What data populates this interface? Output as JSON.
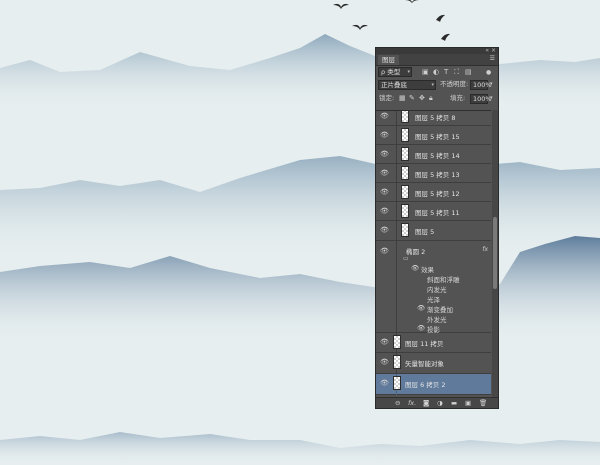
{
  "panel": {
    "tab_label": "图层",
    "menu_icon": "panel-menu-icon",
    "filter": {
      "label": "ρ 类型",
      "icons": [
        "image-filter-icon",
        "adjust-filter-icon",
        "type-filter-icon",
        "shape-filter-icon",
        "smart-filter-icon"
      ]
    },
    "blend_mode": "正片叠底",
    "opacity_label": "不透明度:",
    "opacity_value": "100%",
    "lock_label": "锁定:",
    "fill_label": "填充:",
    "fill_value": "100%"
  },
  "layers": [
    {
      "name": "图层 5 拷贝 8",
      "thumb": "transparent",
      "selected": false
    },
    {
      "name": "图层 5 拷贝 15",
      "thumb": "transparent",
      "selected": false
    },
    {
      "name": "图层 5 拷贝 14",
      "thumb": "transparent",
      "selected": false
    },
    {
      "name": "图层 5 拷贝 13",
      "thumb": "transparent",
      "selected": false
    },
    {
      "name": "图层 5 拷贝 12",
      "thumb": "transparent",
      "selected": false
    },
    {
      "name": "图层 5 拷贝 11",
      "thumb": "transparent",
      "selected": false
    },
    {
      "name": "图层 5",
      "thumb": "transparent",
      "selected": false
    }
  ],
  "shape_layer": {
    "name": "椭圆 2",
    "fx": "fx",
    "effects_label": "效果",
    "effects": [
      "斜面和浮雕",
      "内发光",
      "光泽",
      "渐变叠加",
      "外发光",
      "投影"
    ]
  },
  "lower_layers": [
    {
      "name": "图层 11 拷贝"
    },
    {
      "name": "矢量智能对象"
    },
    {
      "name": "图层 6 拷贝 2"
    }
  ],
  "bottom_bar": [
    "link-icon",
    "fx-icon",
    "mask-icon",
    "adjustment-icon",
    "group-folder-icon",
    "new-layer-icon",
    "trash-icon"
  ],
  "colors": {
    "panel_bg": "#535353",
    "selected": "#5f7a9a",
    "sky": "#e6eeef",
    "mountain_far": "#9bb3c7",
    "mountain_near": "#5e7d9b"
  }
}
